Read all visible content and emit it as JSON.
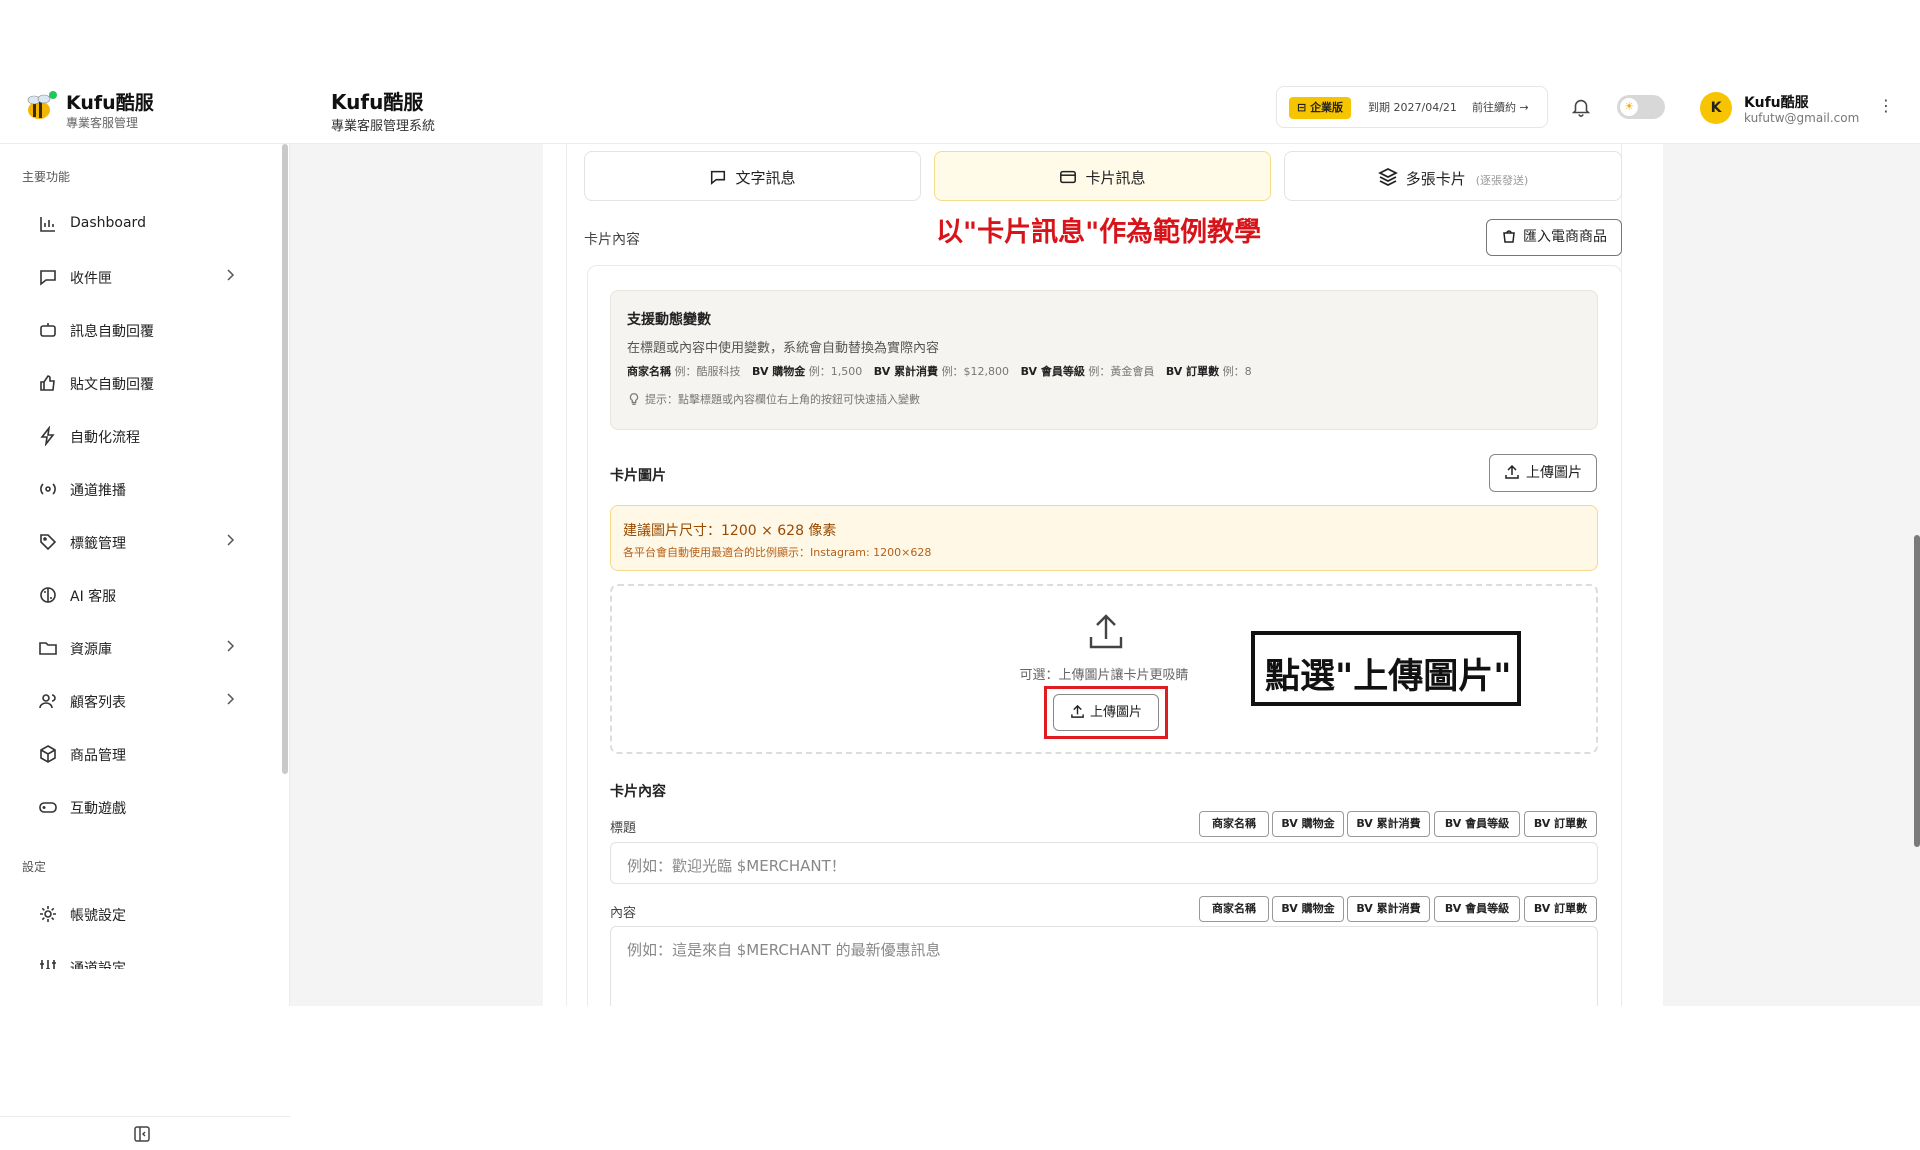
{
  "brand": {
    "title": "Kufu酷服",
    "subtitle": "專業客服管理"
  },
  "header": {
    "title": "Kufu酷服",
    "subtitle": "專業客服管理系統"
  },
  "plan": {
    "badge": "企業版",
    "expire": "到期 2027/04/21",
    "renew": "前往續約 →"
  },
  "user": {
    "avatar_letter": "K",
    "name": "Kufu酷服",
    "email": "kufutw@gmail.com"
  },
  "sidebar": {
    "section_main": "主要功能",
    "section_settings": "設定",
    "items": [
      {
        "label": "Dashboard"
      },
      {
        "label": "收件匣"
      },
      {
        "label": "訊息自動回覆"
      },
      {
        "label": "貼文自動回覆"
      },
      {
        "label": "自動化流程"
      },
      {
        "label": "通道推播"
      },
      {
        "label": "標籤管理"
      },
      {
        "label": "AI 客服"
      },
      {
        "label": "資源庫"
      },
      {
        "label": "顧客列表"
      },
      {
        "label": "商品管理"
      },
      {
        "label": "互動遊戲"
      }
    ],
    "settings_items": [
      {
        "label": "帳號設定"
      },
      {
        "label": "通道設定"
      }
    ]
  },
  "tabs": [
    {
      "label": "文字訊息"
    },
    {
      "label": "卡片訊息"
    },
    {
      "label": "多張卡片",
      "note": "(逐張發送)"
    }
  ],
  "card_content_label": "卡片內容",
  "annotation_top": "以\"卡片訊息\"作為範例教學",
  "import_button": "匯入電商商品",
  "variables": {
    "title": "支援動態變數",
    "description": "在標題或內容中使用變數，系統會自動替換為實際內容",
    "list": [
      {
        "name": "商家名稱",
        "example": "例：酷服科技"
      },
      {
        "name": "BV 購物金",
        "example": "例：1,500"
      },
      {
        "name": "BV 累計消費",
        "example": "例：$12,800"
      },
      {
        "name": "BV 會員等級",
        "example": "例：黃金會員"
      },
      {
        "name": "BV 訂單數",
        "example": "例：8"
      }
    ],
    "tip": "提示：點擊標題或內容欄位右上角的按鈕可快速插入變數"
  },
  "card_image": {
    "label": "卡片圖片",
    "upload_button": "上傳圖片",
    "size_title": "建議圖片尺寸：1200 × 628 像素",
    "size_desc": "各平台會自動使用最適合的比例顯示：Instagram: 1200×628",
    "dropzone_text": "可選：上傳圖片讓卡片更吸睛",
    "dropzone_button": "上傳圖片"
  },
  "annotation_box": "點選\"上傳圖片\"",
  "card_fields": {
    "section_label": "卡片內容",
    "title_label": "標題",
    "title_placeholder": "例如：歡迎光臨 $MERCHANT！",
    "content_label": "內容",
    "content_placeholder": "例如：這是來自 $MERCHANT 的最新優惠訊息",
    "chips": [
      "商家名稱",
      "BV 購物金",
      "BV 累計消費",
      "BV 會員等級",
      "BV 訂單數"
    ]
  }
}
